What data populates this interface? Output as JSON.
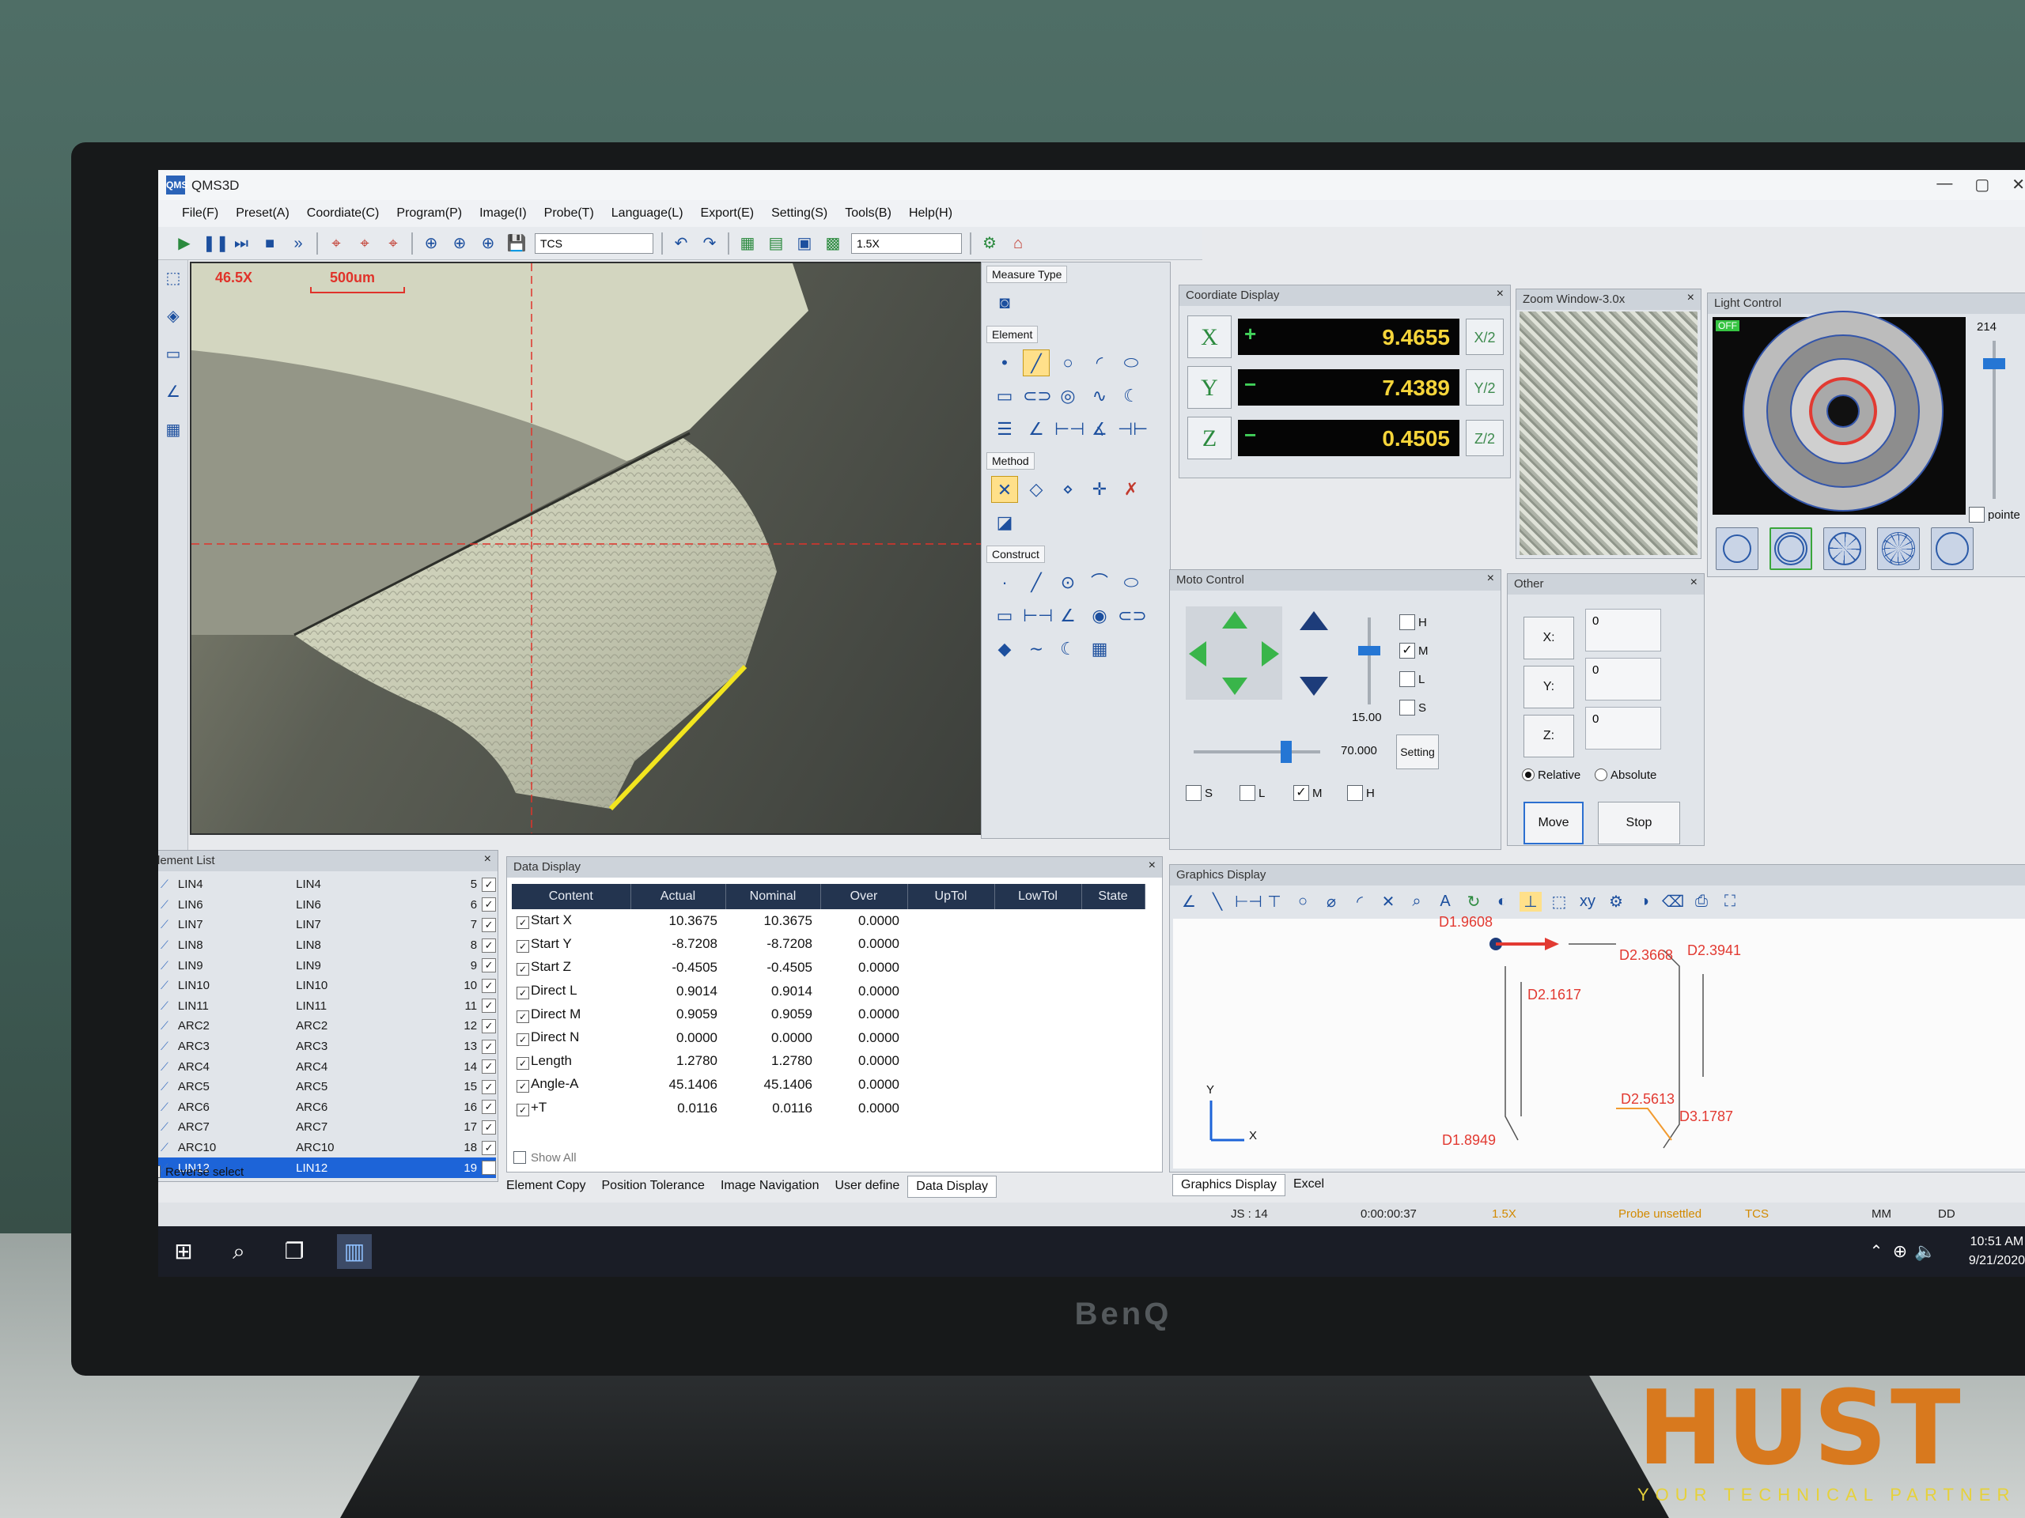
{
  "app": {
    "title": "QMS3D",
    "logo": "QMS"
  },
  "window_controls": [
    "—",
    "▢",
    "✕"
  ],
  "menu": [
    "File(F)",
    "Preset(A)",
    "Coordiate(C)",
    "Program(P)",
    "Image(I)",
    "Probe(T)",
    "Language(L)",
    "Export(E)",
    "Setting(S)",
    "Tools(B)",
    "Help(H)"
  ],
  "toolbar": {
    "coord_system": "TCS",
    "zoom": "1.5X"
  },
  "camera": {
    "magnification": "46.5X",
    "scale": "500um"
  },
  "measure_type": {
    "title": "Measure Type"
  },
  "element_group": {
    "title": "Element"
  },
  "method_group": {
    "title": "Method"
  },
  "construct_group": {
    "title": "Construct"
  },
  "coord_display": {
    "title": "Coordiate Display",
    "rows": [
      {
        "axis": "X",
        "sign": "+",
        "value": "9.4655",
        "half": "X/2"
      },
      {
        "axis": "Y",
        "sign": "−",
        "value": "7.4389",
        "half": "Y/2"
      },
      {
        "axis": "Z",
        "sign": "−",
        "value": "0.4505",
        "half": "Z/2"
      }
    ]
  },
  "zoom_window": {
    "title": "Zoom Window-3.0x"
  },
  "light_control": {
    "title": "Light Control",
    "state": "OFF",
    "level": "214",
    "pointer_label": "pointe",
    "selected_ring_color": "#e23a32"
  },
  "moto_control": {
    "title": "Moto Control",
    "speed_value": "15.00",
    "speed2_value": "70.000",
    "setting_label": "Setting",
    "right_checks": [
      {
        "label": "H",
        "checked": false
      },
      {
        "label": "M",
        "checked": true
      },
      {
        "label": "L",
        "checked": false
      },
      {
        "label": "S",
        "checked": false
      }
    ],
    "bottom_checks": [
      {
        "label": "S",
        "checked": false
      },
      {
        "label": "L",
        "checked": false
      },
      {
        "label": "M",
        "checked": true
      },
      {
        "label": "H",
        "checked": false
      }
    ]
  },
  "other": {
    "title": "Other",
    "fields": [
      {
        "label": "X:",
        "value": "0"
      },
      {
        "label": "Y:",
        "value": "0"
      },
      {
        "label": "Z:",
        "value": "0"
      }
    ],
    "relative_label": "Relative",
    "absolute_label": "Absolute",
    "move_label": "Move",
    "stop_label": "Stop"
  },
  "element_list": {
    "title": "Element List",
    "rows": [
      {
        "name": "LIN4",
        "id": "LIN4",
        "num": "5"
      },
      {
        "name": "LIN6",
        "id": "LIN6",
        "num": "6"
      },
      {
        "name": "LIN7",
        "id": "LIN7",
        "num": "7"
      },
      {
        "name": "LIN8",
        "id": "LIN8",
        "num": "8"
      },
      {
        "name": "LIN9",
        "id": "LIN9",
        "num": "9"
      },
      {
        "name": "LIN10",
        "id": "LIN10",
        "num": "10"
      },
      {
        "name": "LIN11",
        "id": "LIN11",
        "num": "11"
      },
      {
        "name": "ARC2",
        "id": "ARC2",
        "num": "12"
      },
      {
        "name": "ARC3",
        "id": "ARC3",
        "num": "13"
      },
      {
        "name": "ARC4",
        "id": "ARC4",
        "num": "14"
      },
      {
        "name": "ARC5",
        "id": "ARC5",
        "num": "15"
      },
      {
        "name": "ARC6",
        "id": "ARC6",
        "num": "16"
      },
      {
        "name": "ARC7",
        "id": "ARC7",
        "num": "17"
      },
      {
        "name": "ARC10",
        "id": "ARC10",
        "num": "18"
      },
      {
        "name": "LIN12",
        "id": "LIN12",
        "num": "19"
      }
    ],
    "reverse_select": "Reverse select"
  },
  "data_display": {
    "title": "Data Display",
    "columns": [
      "Content",
      "Actual",
      "Nominal",
      "Over",
      "UpTol",
      "LowTol",
      "State"
    ],
    "rows": [
      {
        "content": "Start X",
        "actual": "10.3675",
        "nominal": "10.3675",
        "over": "0.0000"
      },
      {
        "content": "Start Y",
        "actual": "-8.7208",
        "nominal": "-8.7208",
        "over": "0.0000"
      },
      {
        "content": "Start Z",
        "actual": "-0.4505",
        "nominal": "-0.4505",
        "over": "0.0000"
      },
      {
        "content": "Direct L",
        "actual": "0.9014",
        "nominal": "0.9014",
        "over": "0.0000"
      },
      {
        "content": "Direct M",
        "actual": "0.9059",
        "nominal": "0.9059",
        "over": "0.0000"
      },
      {
        "content": "Direct N",
        "actual": "0.0000",
        "nominal": "0.0000",
        "over": "0.0000"
      },
      {
        "content": "Length",
        "actual": "1.2780",
        "nominal": "1.2780",
        "over": "0.0000"
      },
      {
        "content": "Angle-A",
        "actual": "45.1406",
        "nominal": "45.1406",
        "over": "0.0000"
      },
      {
        "content": "+T",
        "actual": "0.0116",
        "nominal": "0.0116",
        "over": "0.0000"
      }
    ],
    "show_all": "Show All"
  },
  "bottom_tabs": [
    "Element Copy",
    "Position Tolerance",
    "Image Navigation",
    "User define",
    "Data Display"
  ],
  "graphics_display": {
    "title": "Graphics Display",
    "tabs": [
      "Graphics Display",
      "Excel"
    ],
    "dims": [
      "D1.9608",
      "D2.3941",
      "D2.3668",
      "D2.1617",
      "D2.5613",
      "D3.1787",
      "D1.8949"
    ],
    "axis_x": "X",
    "axis_y": "Y"
  },
  "status": {
    "js": "JS : 14",
    "time": "0:00:00:37",
    "zoom": "1.5X",
    "probe": "Probe unsettled",
    "cs": "TCS",
    "unit": "MM",
    "angle": "DD"
  },
  "taskbar": {
    "time": "10:51 AM",
    "date": "9/21/2020"
  },
  "monitor_brand": "BenQ",
  "watermark": {
    "text": "HUST",
    "tagline": "YOUR TECHNICAL PARTNER"
  },
  "colors": {
    "accent": "#1d64d8",
    "readout": "#f6d53a",
    "measure_red": "#e23a32",
    "probe_status": "#d28a00"
  }
}
